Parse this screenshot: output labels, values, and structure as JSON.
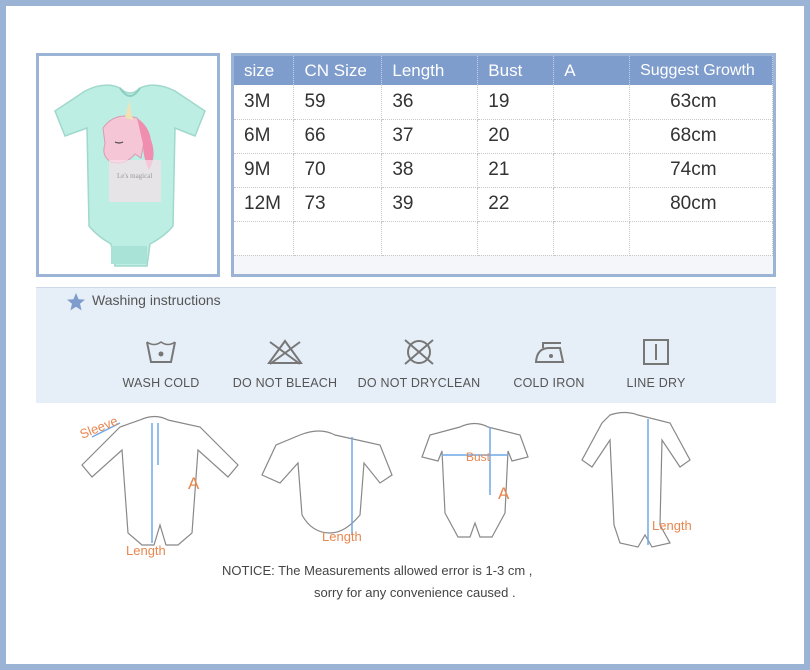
{
  "table": {
    "headers": [
      "size",
      "CN Size",
      "Length",
      "Bust",
      "A",
      "Suggest Growth"
    ],
    "rows": [
      [
        "3M",
        "59",
        "36",
        "19",
        "",
        "63cm"
      ],
      [
        "6M",
        "66",
        "37",
        "20",
        "",
        "68cm"
      ],
      [
        "9M",
        "70",
        "38",
        "21",
        "",
        "74cm"
      ],
      [
        "12M",
        "73",
        "39",
        "22",
        "",
        "80cm"
      ],
      [
        "",
        "",
        "",
        "",
        "",
        ""
      ]
    ]
  },
  "product": {
    "print_text": "Le's magical"
  },
  "washing": {
    "title": "Washing instructions",
    "items": [
      {
        "label": "WASH COLD",
        "icon": "wash-cold-icon"
      },
      {
        "label": "DO NOT BLEACH",
        "icon": "no-bleach-icon"
      },
      {
        "label": "DO NOT DRYCLEAN",
        "icon": "no-dryclean-icon"
      },
      {
        "label": "COLD IRON",
        "icon": "cold-iron-icon"
      },
      {
        "label": "LINE DRY",
        "icon": "line-dry-icon"
      }
    ]
  },
  "diagram_labels": {
    "sleeve": "Sleeve",
    "a1": "A",
    "length1": "Length",
    "length2": "Length",
    "bust": "Bust",
    "a2": "A",
    "length3": "Length"
  },
  "notice": {
    "line1": "NOTICE:   The Measurements allowed error is 1-3 cm ,",
    "line2": "sorry for any convenience caused ."
  },
  "colors": {
    "frame": "#9bb4d6",
    "header": "#7e9ccc",
    "measure": "#6fa8e8",
    "label": "#e8874f",
    "garment": "#8ad8cf"
  }
}
